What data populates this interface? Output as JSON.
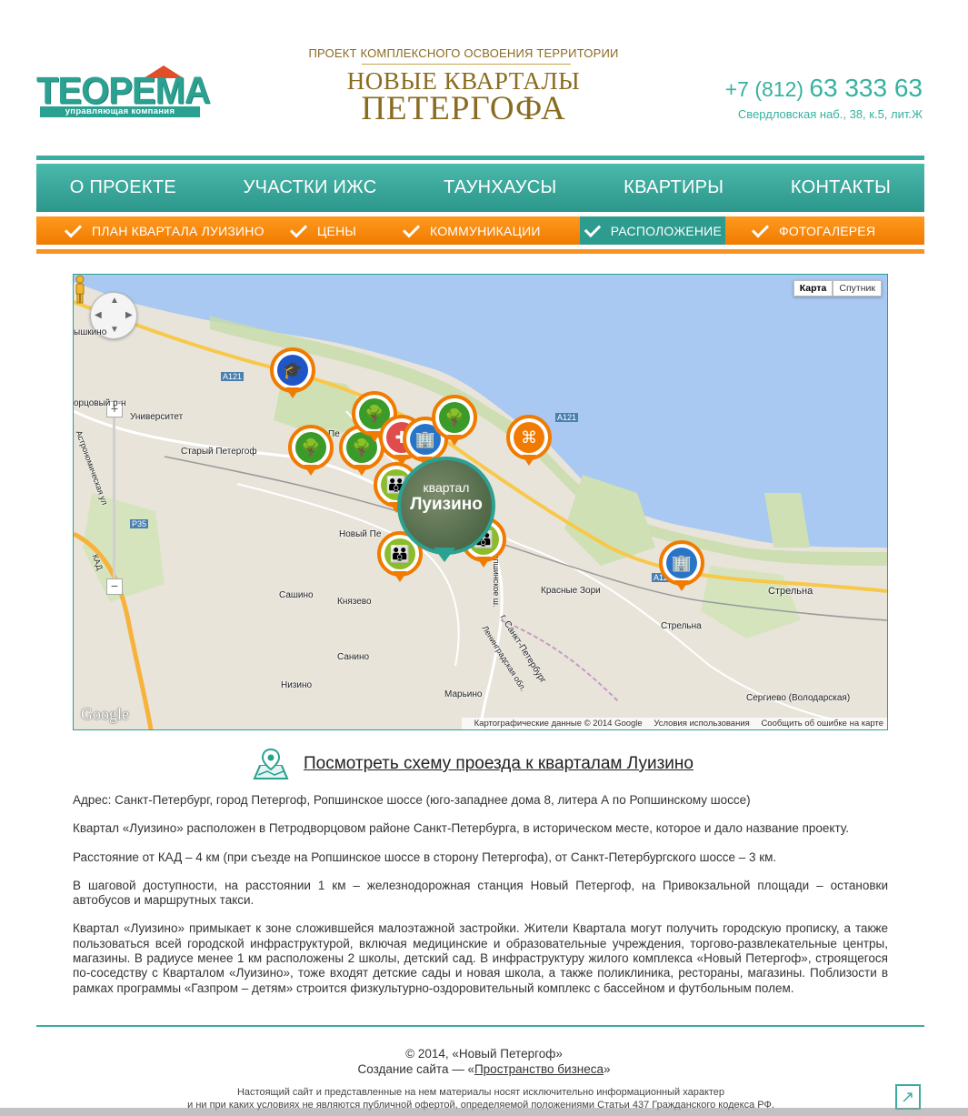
{
  "header": {
    "logo_text": "ТЕОРЕМА",
    "logo_sub": "управляющая компания",
    "project_subtitle": "ПРОЕКТ КОМПЛЕКСНОГО ОСВОЕНИЯ ТЕРРИТОРИИ",
    "project_title_1": "НОВЫЕ КВАРТАЛЫ",
    "project_title_2": "ПЕТЕРГОФА",
    "phone_code": "+7 (812)",
    "phone_number": "63 333 63",
    "address": "Свердловская наб., 38, к.5, лит.Ж"
  },
  "nav": {
    "main": [
      "О ПРОЕКТЕ",
      "УЧАСТКИ ИЖС",
      "ТАУНХАУСЫ",
      "КВАРТИРЫ",
      "КОНТАКТЫ"
    ],
    "sub": [
      "ПЛАН КВАРТАЛА ЛУИЗИНО",
      "ЦЕНЫ",
      "КОММУНИКАЦИИ",
      "РАСПОЛОЖЕНИЕ",
      "ФОТОГАЛЕРЕЯ"
    ],
    "active_sub": "РАСПОЛОЖЕНИЕ"
  },
  "map": {
    "type_map": "Карта",
    "type_sat": "Спутник",
    "center_label_1": "квартал",
    "center_label_2": "Луизино",
    "google": "Google",
    "footer_data": "Картографические данные © 2014 Google",
    "footer_terms": "Условия использования",
    "footer_report": "Сообщить об ошибке на карте",
    "places": {
      "ryshkino": "ышкино",
      "dvortsovy": "орцовый р-н",
      "universitet": "Университет",
      "stary": "Старый Петергоф",
      "novy": "Новый Пе",
      "pe": "Пе",
      "sashino": "Сашино",
      "knyazevo": "Князево",
      "sanino": "Санино",
      "nizino": "Низино",
      "marino": "Марьино",
      "krasnye": "Красные Зори",
      "strelna1": "Стрельна",
      "strelna2": "Стрельна",
      "sergievo": "Сергиево (Володарская)",
      "spb": "г. Санкт-Петербург",
      "len": "Ленинградская обл.",
      "ropsha": "Ропшинское ш.",
      "astro": "Астрономическая ул",
      "kad": "КАД",
      "a121": "A121",
      "a121b": "A121",
      "a120": "A12",
      "p35": "P35"
    }
  },
  "route_link": "Посмотреть схему проезда к кварталам Луизино",
  "content": [
    "Адрес: Санкт-Петербург, город Петергоф, Ропшинское шоссе (юго-западнее дома 8, литера А по Ропшинскому шоссе)",
    "Квартал «Луизино» расположен в Петродворцовом районе Санкт-Петербурга, в историческом месте, которое и дало название проекту.",
    "Расстояние от КАД – 4 км (при съезде на Ропшинское шоссе в сторону Петергофа), от Санкт-Петербургского шоссе – 3 км.",
    "В шаговой доступности, на расстоянии 1 км – железнодорожная станция Новый Петергоф, на Привокзальной площади – остановки автобусов и маршрутных такси.",
    "Квартал «Луизино» примыкает к зоне сложившейся малоэтажной застройки. Жители Квартала могут получить городскую прописку, а также пользоваться всей городской инфраструктурой, включая медицинские и образовательные учреждения, торгово-развлекательные центры, магазины. В радиусе менее 1 км расположены 2 школы, детский сад. В инфраструктуру жилого комплекса «Новый Петергоф», строящегося по-соседству с Кварталом «Луизино», тоже входят детские сады и новая школа, а также поликлиника, рестораны, магазины. Поблизости в рамках программы «Газпром – детям» строится физкультурно-оздоровительный комплекс с бассейном и футбольным полем."
  ],
  "footer": {
    "copyright": "© 2014, «Новый Петергоф»",
    "created_prefix": "Создание сайта — «",
    "created_link": "Пространство бизнеса",
    "created_suffix": "»",
    "disclaimer_1": "Настоящий сайт и представленные на нем материалы носят исключительно информационный характер",
    "disclaimer_2": "и ни при каких условиях не являются публичной офертой, определяемой положениями Статьи 437 Гражданского кодекса РФ."
  },
  "colors": {
    "teal": "#2aa191",
    "orange": "#f07b00",
    "gold": "#8a6b20"
  }
}
